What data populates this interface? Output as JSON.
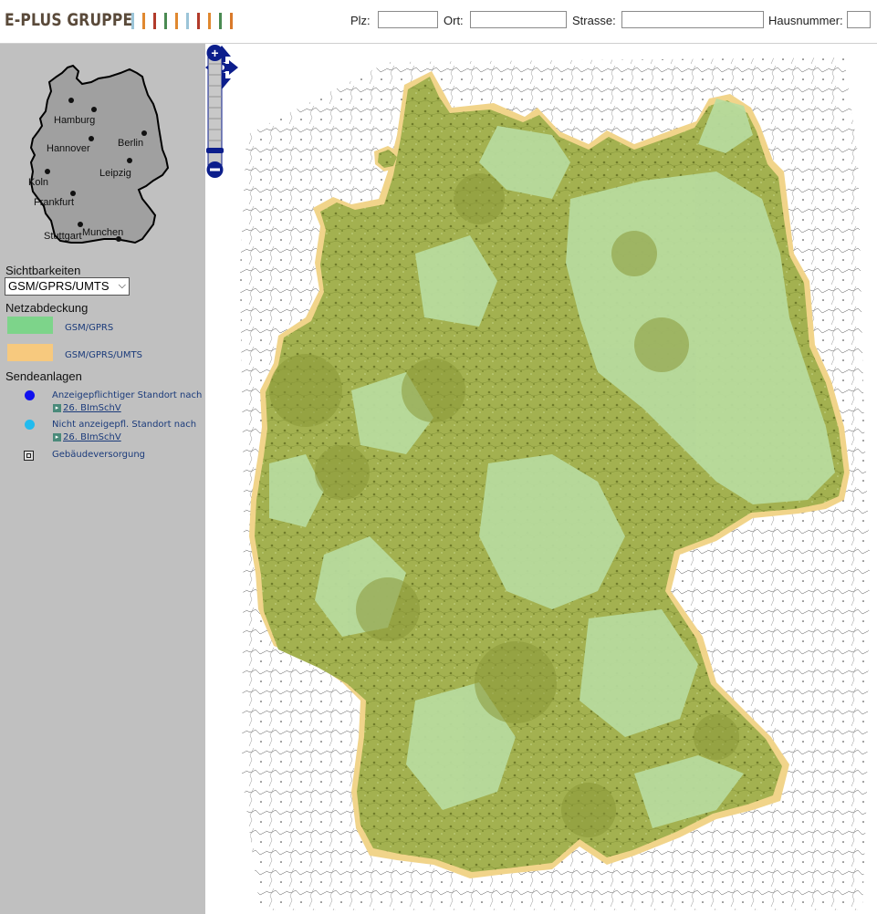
{
  "header": {
    "logo": "E-PLUS GRUPPE",
    "stripe_colors": [
      "#9bc4d8",
      "#e0882f",
      "#b23a2a",
      "#4a8a52",
      "#e0882f",
      "#9bc4d8",
      "#b23a2a",
      "#e0882f",
      "#4a8a52",
      "#d97a2a"
    ],
    "fields": {
      "plz_label": "Plz:",
      "ort_label": "Ort:",
      "strasse_label": "Strasse:",
      "hausnummer_label": "Hausnummer:",
      "plz_value": "",
      "ort_value": "",
      "strasse_value": "",
      "hausnummer_value": ""
    }
  },
  "sidebar": {
    "minimap_cities": [
      "Hamburg",
      "Berlin",
      "Hannover",
      "Leipzig",
      "Koln",
      "Frankfurt",
      "Stuttgart",
      "Munchen"
    ],
    "visibility_title": "Sichtbarkeiten",
    "visibility_selected": "GSM/GPRS/UMTS",
    "coverage_title": "Netzabdeckung",
    "coverage": [
      {
        "label": "GSM/GPRS",
        "color": "#7dd48a"
      },
      {
        "label": "GSM/GPRS/UMTS",
        "color": "#f7c97e"
      }
    ],
    "sites_title": "Sendeanlagen",
    "sites": [
      {
        "label": "Anzeigepflichtiger Standort nach",
        "link": "26. BImSchV",
        "color": "#1010ee"
      },
      {
        "label": "Nicht anzeigepfl. Standort nach",
        "link": "26. BImSchV",
        "color": "#22bbee"
      },
      {
        "label": "Gebäudeversorgung"
      }
    ]
  },
  "map": {
    "colors": {
      "dark_coverage": "#9fae4a",
      "light_coverage": "#b8dca0",
      "umts_fringe": "#f1d48a",
      "background": "#ffffff",
      "nav_blue": "#0c1e8c"
    }
  }
}
